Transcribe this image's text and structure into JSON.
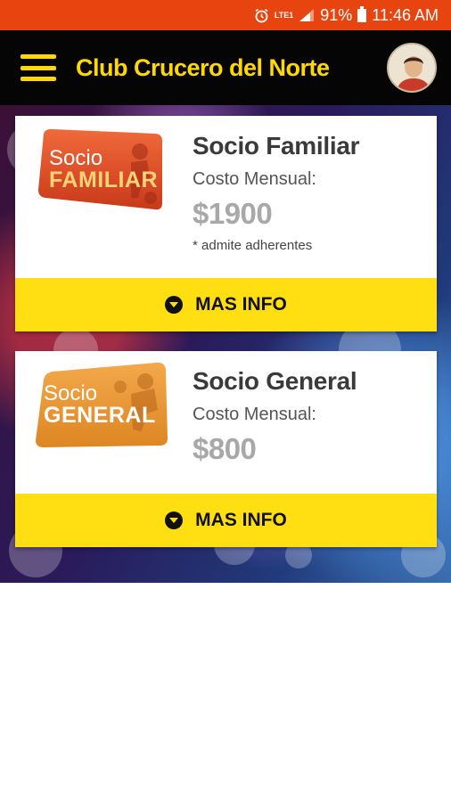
{
  "status_bar": {
    "lte_line1": "LTE",
    "lte_line2": "1",
    "battery": "91%",
    "time": "11:46 AM",
    "icons": [
      "alarm-icon",
      "lte-icon",
      "signal-icon",
      "battery-icon"
    ]
  },
  "app_bar": {
    "title": "Club Crucero del Norte",
    "menu_icon": "hamburger-menu-icon",
    "avatar": "user-avatar"
  },
  "colors": {
    "status_bar": "#e8440f",
    "app_bar": "#050505",
    "accent_yellow": "#ffd800",
    "button_yellow": "#ffdf12",
    "price_gray": "#a8a8a8"
  },
  "plans": [
    {
      "badge_line1": "Socio",
      "badge_line2": "FAMILIAR",
      "title": "Socio Familiar",
      "cost_label": "Costo Mensual:",
      "price": "$1900",
      "note": "* admite adherentes",
      "button_label": "MAS INFO",
      "button_icon": "chevron-down-circle-icon"
    },
    {
      "badge_line1": "Socio",
      "badge_line2": "GENERAL",
      "title": "Socio General",
      "cost_label": "Costo Mensual:",
      "price": "$800",
      "button_label": "MAS INFO",
      "button_icon": "chevron-down-circle-icon"
    }
  ]
}
